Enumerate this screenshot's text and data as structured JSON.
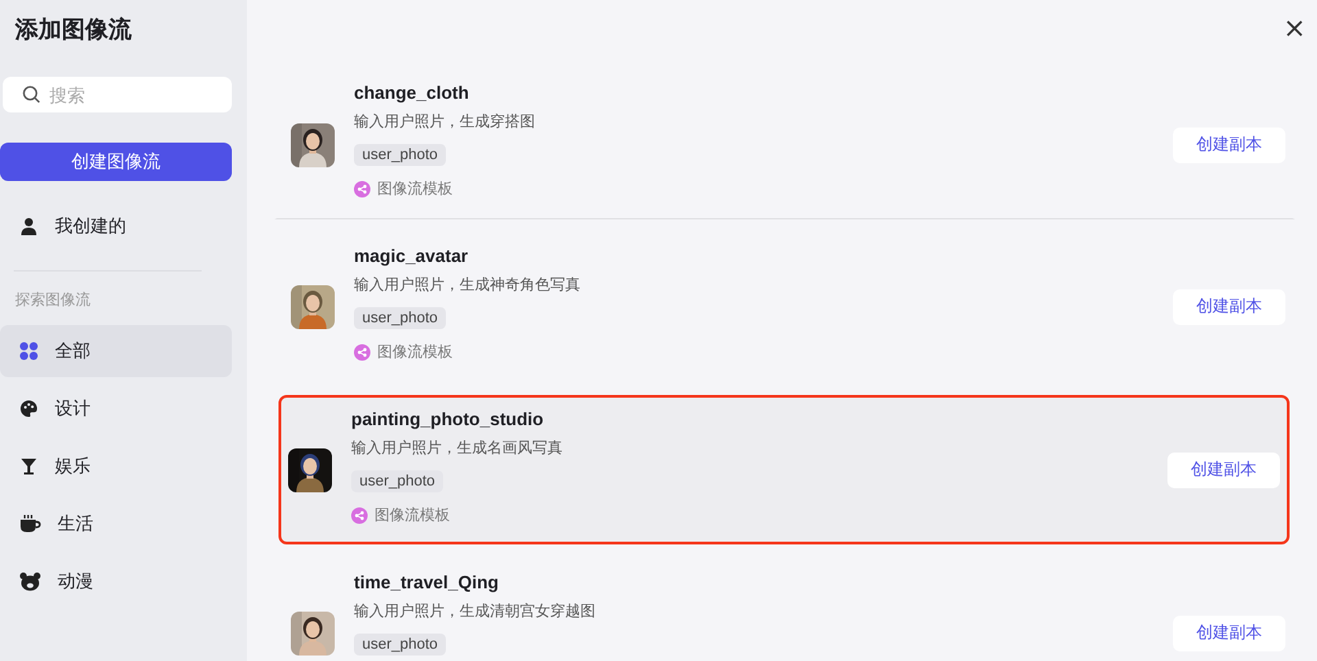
{
  "sidebar": {
    "title": "添加图像流",
    "search": {
      "placeholder": "搜索"
    },
    "create_button": "创建图像流",
    "mine": "我创建的",
    "section_label": "探索图像流",
    "items": [
      {
        "kind": "all",
        "label": "全部",
        "selected": true
      },
      {
        "kind": "design",
        "label": "设计",
        "selected": false
      },
      {
        "kind": "entertainment",
        "label": "娱乐",
        "selected": false
      },
      {
        "kind": "life",
        "label": "生活",
        "selected": false
      },
      {
        "kind": "anime",
        "label": "动漫",
        "selected": false
      }
    ]
  },
  "close": "×",
  "workflows": [
    {
      "name": "change_cloth",
      "description": "输入用户照片，生成穿搭图",
      "tag": "user_photo",
      "template": "图像流模板",
      "button": "创建副本",
      "highlighted": false,
      "divider_below": true
    },
    {
      "name": "magic_avatar",
      "description": "输入用户照片，生成神奇角色写真",
      "tag": "user_photo",
      "template": "图像流模板",
      "button": "创建副本",
      "highlighted": false,
      "divider_below": false
    },
    {
      "name": "painting_photo_studio",
      "description": "输入用户照片，生成名画风写真",
      "tag": "user_photo",
      "template": "图像流模板",
      "button": "创建副本",
      "highlighted": true,
      "divider_below": false
    },
    {
      "name": "time_travel_Qing",
      "description": "输入用户照片，生成清朝宫女穿越图",
      "tag": "user_photo",
      "button": "创建副本",
      "highlighted": false,
      "divider_below": false
    }
  ]
}
